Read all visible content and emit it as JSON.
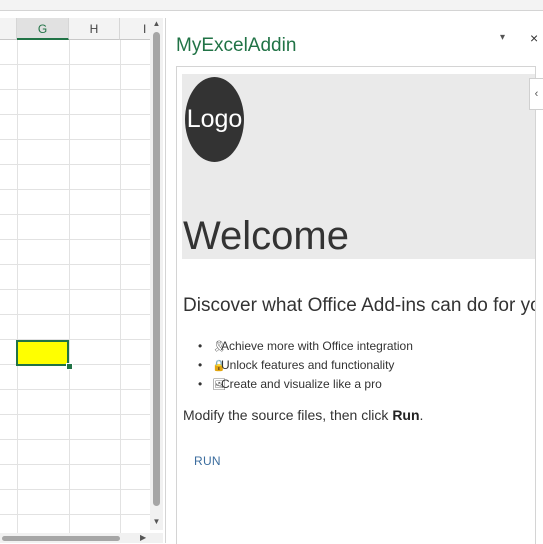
{
  "sheet": {
    "columns": [
      "G",
      "H",
      "I"
    ],
    "selected_column": "G"
  },
  "taskpane": {
    "title": "MyExcelAddin",
    "menu_glyph": "▾",
    "close_glyph": "×",
    "collapse_glyph": "‹",
    "logo_text": "Logo",
    "welcome": "Welcome",
    "discover": "Discover what Office Add-ins can do for you today!",
    "features": [
      {
        "icon": "ribbon-icon",
        "glyph": "🎗",
        "text": "Achieve more with Office integration"
      },
      {
        "icon": "lock-icon",
        "glyph": "🔒",
        "text": "Unlock features and functionality"
      },
      {
        "icon": "design-icon",
        "glyph": "🖼",
        "text": "Create and visualize like a pro"
      }
    ],
    "modify_prefix": "Modify the source files, then click ",
    "modify_bold": "Run",
    "modify_suffix": ".",
    "run_button": "RUN"
  },
  "colors": {
    "accent": "#217346",
    "selected_cell_fill": "#ffff00",
    "link": "#3c6d9e"
  }
}
